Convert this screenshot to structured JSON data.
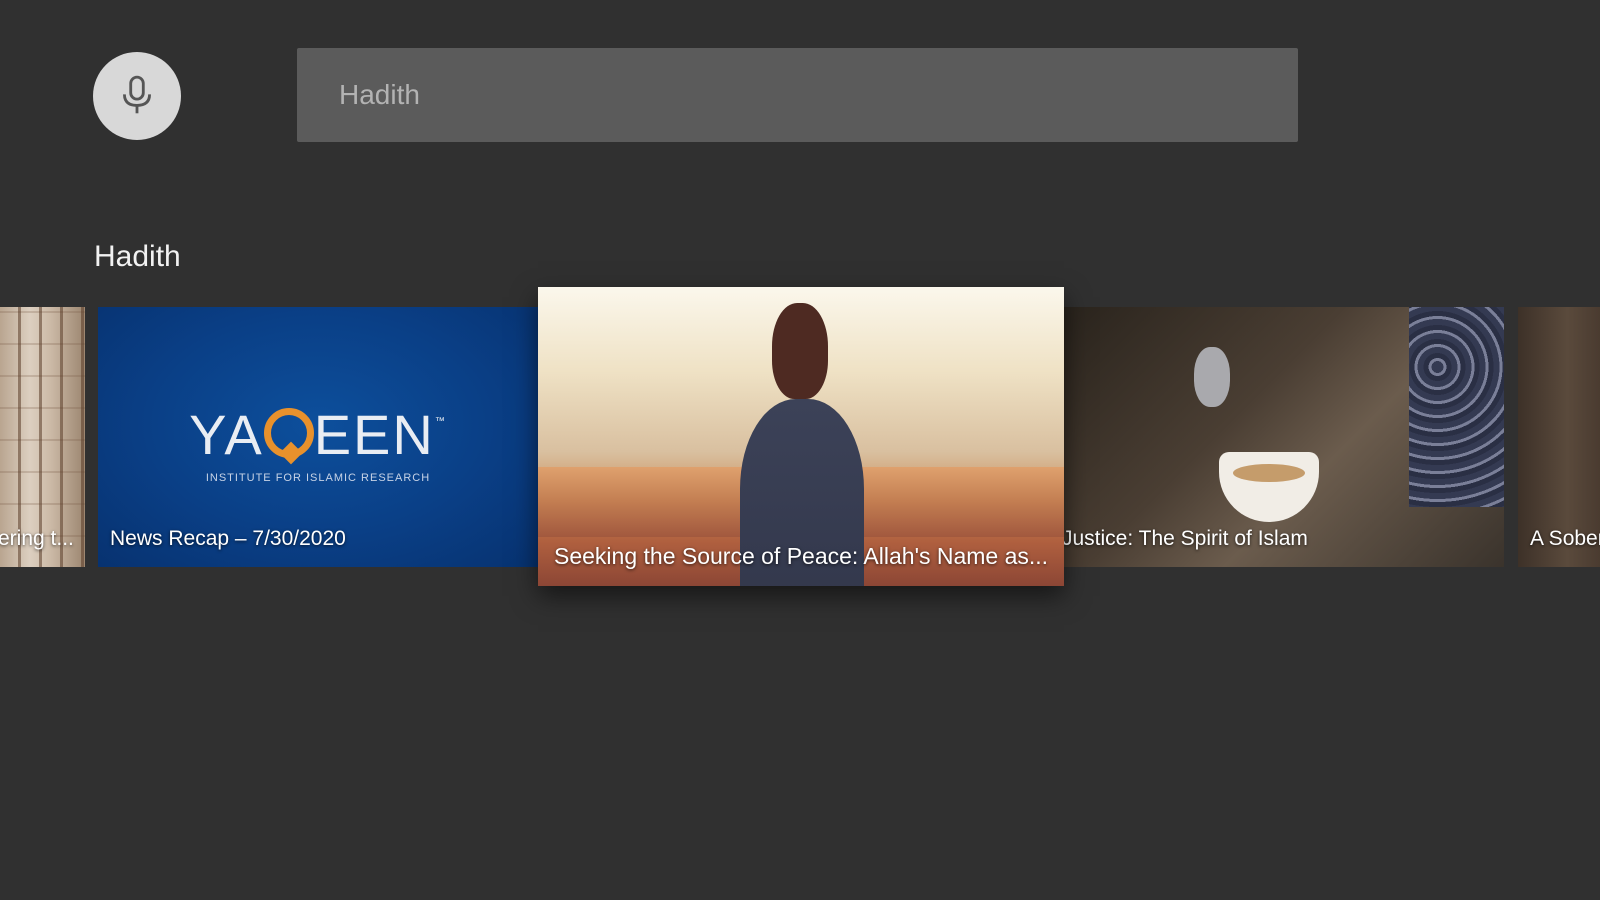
{
  "search": {
    "placeholder": "Hadith"
  },
  "row": {
    "title": "Hadith",
    "cards": [
      {
        "label": "ering t..."
      },
      {
        "label": "News Recap – 7/30/2020",
        "logo_text": "YAQEEN",
        "logo_sub": "INSTITUTE FOR ISLAMIC RESEARCH",
        "logo_tm": "™"
      },
      {
        "label": "Seeking the Source of Peace: Allah's Name as..."
      },
      {
        "label": "Justice: The Spirit of Islam"
      },
      {
        "label": "A Sober"
      }
    ]
  },
  "colors": {
    "background": "#303030",
    "search_bar": "#5b5b5b",
    "mic_button": "#d8d8d8",
    "yaqeen_blue": "#0a3f86",
    "yaqeen_orange": "#e8912c"
  },
  "icons": {
    "mic": "microphone-icon"
  }
}
